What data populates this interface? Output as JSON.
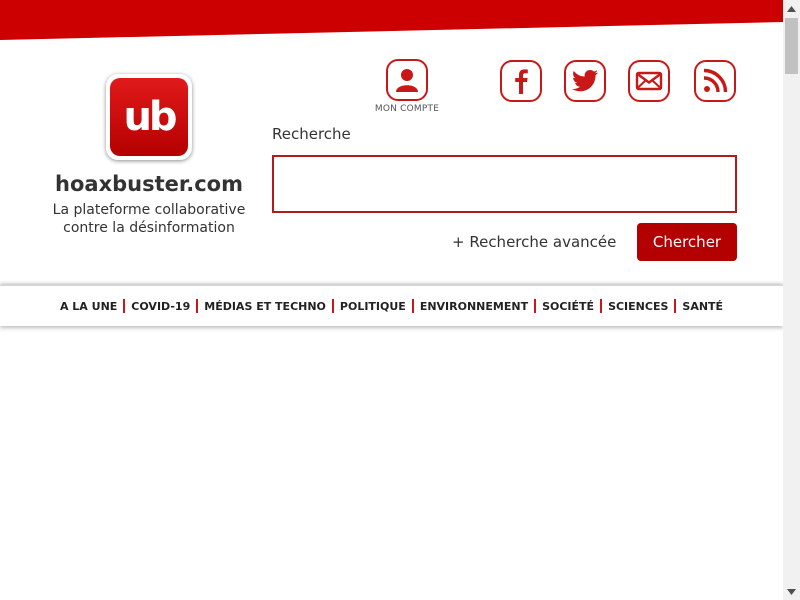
{
  "header": {
    "logo_text": "ub",
    "site_name": "hoaxbuster.com",
    "tagline_line1": "La plateforme collaborative",
    "tagline_line2": "contre la désinformation"
  },
  "account": {
    "label": "MON COMPTE"
  },
  "social": [
    "facebook",
    "twitter",
    "email",
    "rss"
  ],
  "search": {
    "label": "Recherche",
    "value": "",
    "placeholder": "",
    "advanced_link": "+ Recherche avancée",
    "submit_label": "Chercher"
  },
  "nav": {
    "items": [
      "A LA UNE",
      "COVID-19",
      "MÉDIAS ET TECHNO",
      "POLITIQUE",
      "ENVIRONNEMENT",
      "SOCIÉTÉ",
      "SCIENCES",
      "SANTÉ"
    ]
  },
  "colors": {
    "brand_red": "#c81818",
    "button_red": "#b30000"
  }
}
